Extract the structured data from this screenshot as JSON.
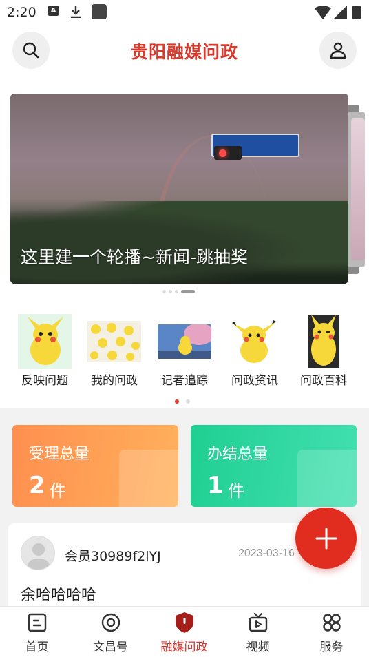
{
  "status_bar": {
    "time": "2:20"
  },
  "header": {
    "title": "贵阳融媒问政"
  },
  "banner": {
    "caption": "这里建一个轮播~新闻-跳抽奖"
  },
  "quick_menu": {
    "items": [
      {
        "label": "反映问题",
        "icon": "pikachu-icon"
      },
      {
        "label": "我的问政",
        "icon": "pikachu-pattern-icon"
      },
      {
        "label": "记者追踪",
        "icon": "pikachu-scene-icon"
      },
      {
        "label": "问政资讯",
        "icon": "pikachu-icon"
      },
      {
        "label": "问政百科",
        "icon": "pikachu-wink-icon"
      }
    ]
  },
  "stats": {
    "accepted": {
      "title": "受理总量",
      "value": "2",
      "unit": "件",
      "color": "#ff9a52"
    },
    "completed": {
      "title": "办结总量",
      "value": "1",
      "unit": "件",
      "color": "#2ad69c"
    }
  },
  "post": {
    "user": "会员30989f2lYJ",
    "date": "2023-03-16",
    "text": "余哈哈哈哈"
  },
  "bottom_nav": {
    "items": [
      {
        "label": "首页",
        "icon": "home-icon"
      },
      {
        "label": "文昌号",
        "icon": "target-icon"
      },
      {
        "label": "融媒问政",
        "icon": "shield-icon",
        "active": true
      },
      {
        "label": "视频",
        "icon": "tv-icon"
      },
      {
        "label": "服务",
        "icon": "services-icon"
      }
    ]
  },
  "colors": {
    "accent": "#d8332a",
    "fab": "#e02d20"
  }
}
